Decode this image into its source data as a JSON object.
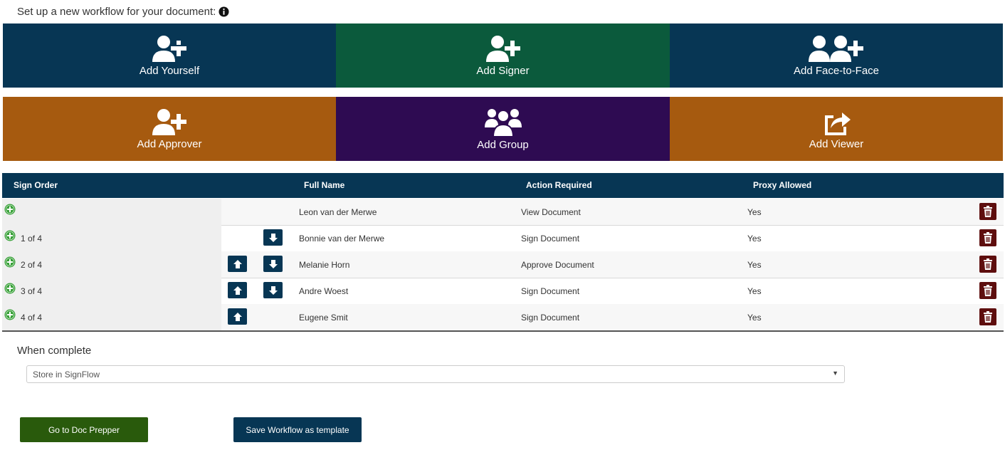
{
  "intro": {
    "text": "Set up a new workflow for your document:"
  },
  "tiles": {
    "add_yourself": {
      "label": "Add Yourself",
      "color": "#073654"
    },
    "add_signer": {
      "label": "Add Signer",
      "color": "#0b5a3c"
    },
    "add_face_to_face": {
      "label": "Add Face-to-Face",
      "color": "#073654"
    },
    "add_approver": {
      "label": "Add Approver",
      "color": "#a65a0f"
    },
    "add_group": {
      "label": "Add Group",
      "color": "#2e0b52"
    },
    "add_viewer": {
      "label": "Add Viewer",
      "color": "#a65a0f"
    }
  },
  "table": {
    "headers": {
      "sign_order": "Sign Order",
      "full_name": "Full Name",
      "action_required": "Action Required",
      "proxy_allowed": "Proxy Allowed"
    },
    "rows": [
      {
        "order": "",
        "name": "Leon van der Merwe",
        "action": "View Document",
        "proxy": "Yes",
        "up": false,
        "down": false
      },
      {
        "order": "1 of 4",
        "name": "Bonnie van der Merwe",
        "action": "Sign Document",
        "proxy": "Yes",
        "up": false,
        "down": true
      },
      {
        "order": "2 of 4",
        "name": "Melanie Horn",
        "action": "Approve Document",
        "proxy": "Yes",
        "up": true,
        "down": true
      },
      {
        "order": "3 of 4",
        "name": "Andre Woest",
        "action": "Sign Document",
        "proxy": "Yes",
        "up": true,
        "down": true
      },
      {
        "order": "4 of 4",
        "name": "Eugene Smit",
        "action": "Sign Document",
        "proxy": "Yes",
        "up": true,
        "down": false
      }
    ]
  },
  "when_complete": {
    "label": "When complete",
    "selected": "Store in SignFlow"
  },
  "buttons": {
    "doc_prepper": {
      "label": "Go to Doc Prepper",
      "color": "#295a0c"
    },
    "save_template": {
      "label": "Save Workflow as template",
      "color": "#073654"
    }
  },
  "colors": {
    "plus": "#3aa23a",
    "trash": "#5e0e0e",
    "header": "#073654"
  }
}
